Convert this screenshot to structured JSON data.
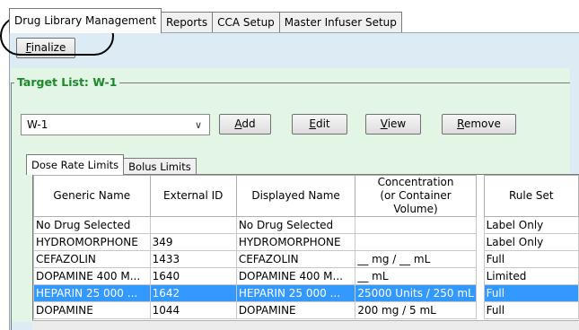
{
  "main_tabs": [
    {
      "label": "Drug Library Management",
      "active": true
    },
    {
      "label": "Reports",
      "active": false
    },
    {
      "label": "CCA Setup",
      "active": false
    },
    {
      "label": "Master Infuser Setup",
      "active": false
    }
  ],
  "toolbar": {
    "finalize_label": "inalize",
    "finalize_mnemonic": "F"
  },
  "target_list": {
    "title": "Target List: W-1",
    "selected": "W-1",
    "buttons": {
      "add": {
        "mnemonic": "A",
        "rest": "dd"
      },
      "edit": {
        "mnemonic": "E",
        "rest": "dit"
      },
      "view": {
        "mnemonic": "V",
        "rest": "iew"
      },
      "remove": {
        "mnemonic": "R",
        "rest": "emove"
      }
    }
  },
  "sub_tabs": [
    {
      "label": "Dose Rate Limits",
      "active": true
    },
    {
      "label": "Bolus Limits",
      "active": false
    }
  ],
  "table": {
    "headers": {
      "generic_name": "Generic Name",
      "external_id": "External ID",
      "displayed_name": "Displayed Name",
      "concentration_line1": "Concentration",
      "concentration_line2": "(or Container Volume)",
      "rule_set": "Rule Set"
    },
    "rows": [
      {
        "generic": "No Drug Selected",
        "ext_id": "",
        "displayed": "No Drug Selected",
        "concentration": "",
        "rule": "Label Only",
        "selected": false
      },
      {
        "generic": "HYDROMORPHONE",
        "ext_id": "349",
        "displayed": "HYDROMORPHONE",
        "concentration": "",
        "rule": "Label Only",
        "selected": false
      },
      {
        "generic": "CEFAZOLIN",
        "ext_id": "1433",
        "displayed": "CEFAZOLIN",
        "concentration": "__ mg / __ mL",
        "rule": "Full",
        "selected": false
      },
      {
        "generic": "DOPAMINE 400 M...",
        "ext_id": "1640",
        "displayed": "DOPAMINE 400 M...",
        "concentration": "__ mL",
        "rule": "Limited",
        "selected": false
      },
      {
        "generic": "HEPARIN 25 000 ...",
        "ext_id": "1642",
        "displayed": "HEPARIN 25 000 ...",
        "concentration": "25000 Units / 250 mL",
        "rule": "Full",
        "selected": true
      },
      {
        "generic": "DOPAMINE",
        "ext_id": "1044",
        "displayed": "DOPAMINE",
        "concentration": "200 mg / 5 mL",
        "rule": "Full",
        "selected": false
      }
    ]
  },
  "colors": {
    "panel_bg": "#dcebf4",
    "group_bg": "#e3f6e5",
    "group_title": "#1a8a2a",
    "selection": "#3399ff"
  }
}
